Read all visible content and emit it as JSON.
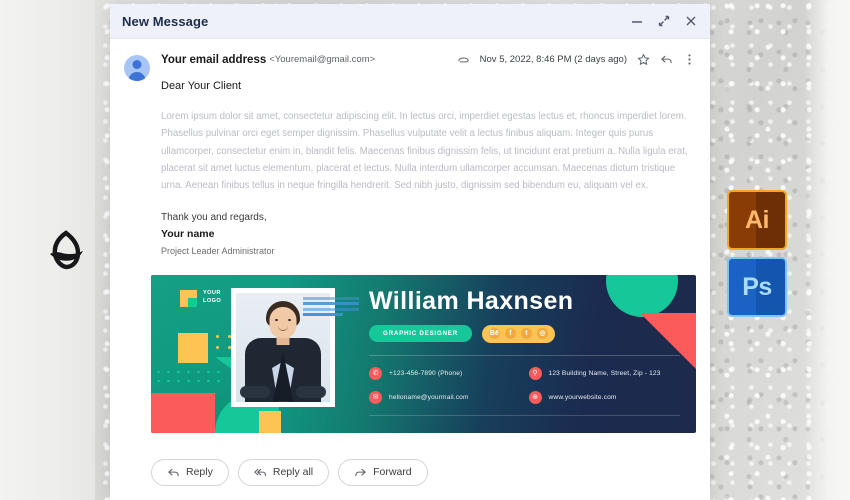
{
  "window": {
    "title": "New Message",
    "controls": [
      {
        "name": "minimize",
        "glyph": "–"
      },
      {
        "name": "collapse",
        "glyph": "↙↗"
      },
      {
        "name": "close",
        "glyph": "✕"
      }
    ]
  },
  "message": {
    "sender_name": "Your email address",
    "sender_email": "<Youremail@gmail.com>",
    "date": "Nov 5, 2022, 8:46 PM (2 days ago)",
    "attachment_icon": "paperclip-icon",
    "star_icon": "star-icon",
    "reply_icon": "reply-arrow-icon",
    "more_icon": "kebab-menu-icon",
    "greeting": "Dear Your Client",
    "body": "Lorem ipsum dolor sit amet, consectetur adipiscing elit. In lectus orci, imperdiet egestas lectus et, rhoncus imperdiet lorem. Phasellus pulvinar orci eget semper dignissim. Phasellus vulputate velit a lectus finibus aliquam. Integer quis purus ullamcorper, consectetur enim in, blandit felis. Maecenas finibus dignissim felis, ut tincidunt erat pretium a. Nulla ligula erat, placerat sit amet luctus elementum, placerat et lectus. Nulla interdum ullamcorper accumsan. Maecenas dictum tristique urna. Aenean finibus tellus in neque fringilla hendrerit. Sed nibh justo, dignissim sed bibendum eu, aliquam vel ex.",
    "signoff_line": "Thank you and regards,",
    "signoff_name": "Your name",
    "signoff_role": "Project Leader Administrator"
  },
  "banner": {
    "logo_text": "YOUR\nLOGO",
    "name": "William Haxnsen",
    "role": "GRAPHIC DESIGNER",
    "social": [
      {
        "name": "behance-icon",
        "glyph": "Bē"
      },
      {
        "name": "facebook-icon",
        "glyph": "f"
      },
      {
        "name": "twitter-icon",
        "glyph": "t"
      },
      {
        "name": "instagram-icon",
        "glyph": "◎"
      }
    ],
    "contacts": [
      {
        "icon": "phone-icon",
        "glyph": "✆",
        "text": "+123-456-7890 (Phone)"
      },
      {
        "icon": "location-icon",
        "glyph": "⚲",
        "text": "123 Building Name, Street, Zip - 123"
      },
      {
        "icon": "email-icon",
        "glyph": "✉",
        "text": "helloname@yourmail.com"
      },
      {
        "icon": "globe-icon",
        "glyph": "⊕",
        "text": "www.yourwebsite.com"
      }
    ]
  },
  "actions": [
    {
      "name": "reply-button",
      "label": "Reply",
      "icon": "reply-arrow-icon"
    },
    {
      "name": "reply-all-button",
      "label": "Reply all",
      "icon": "reply-all-arrow-icon"
    },
    {
      "name": "forward-button",
      "label": "Forward",
      "icon": "forward-arrow-icon"
    }
  ],
  "desktop": {
    "brand_logo": "leaf-swoosh-logo-icon",
    "apps": [
      {
        "name": "adobe-illustrator-icon",
        "label": "Ai"
      },
      {
        "name": "adobe-photoshop-icon",
        "label": "Ps"
      }
    ]
  },
  "colors": {
    "banner_teal": "#14a085",
    "banner_navy": "#1d2a4d",
    "accent_green": "#16c79a",
    "accent_yellow": "#fdc453",
    "accent_red": "#fb5b5b",
    "title_bar": "#eef1f9"
  }
}
